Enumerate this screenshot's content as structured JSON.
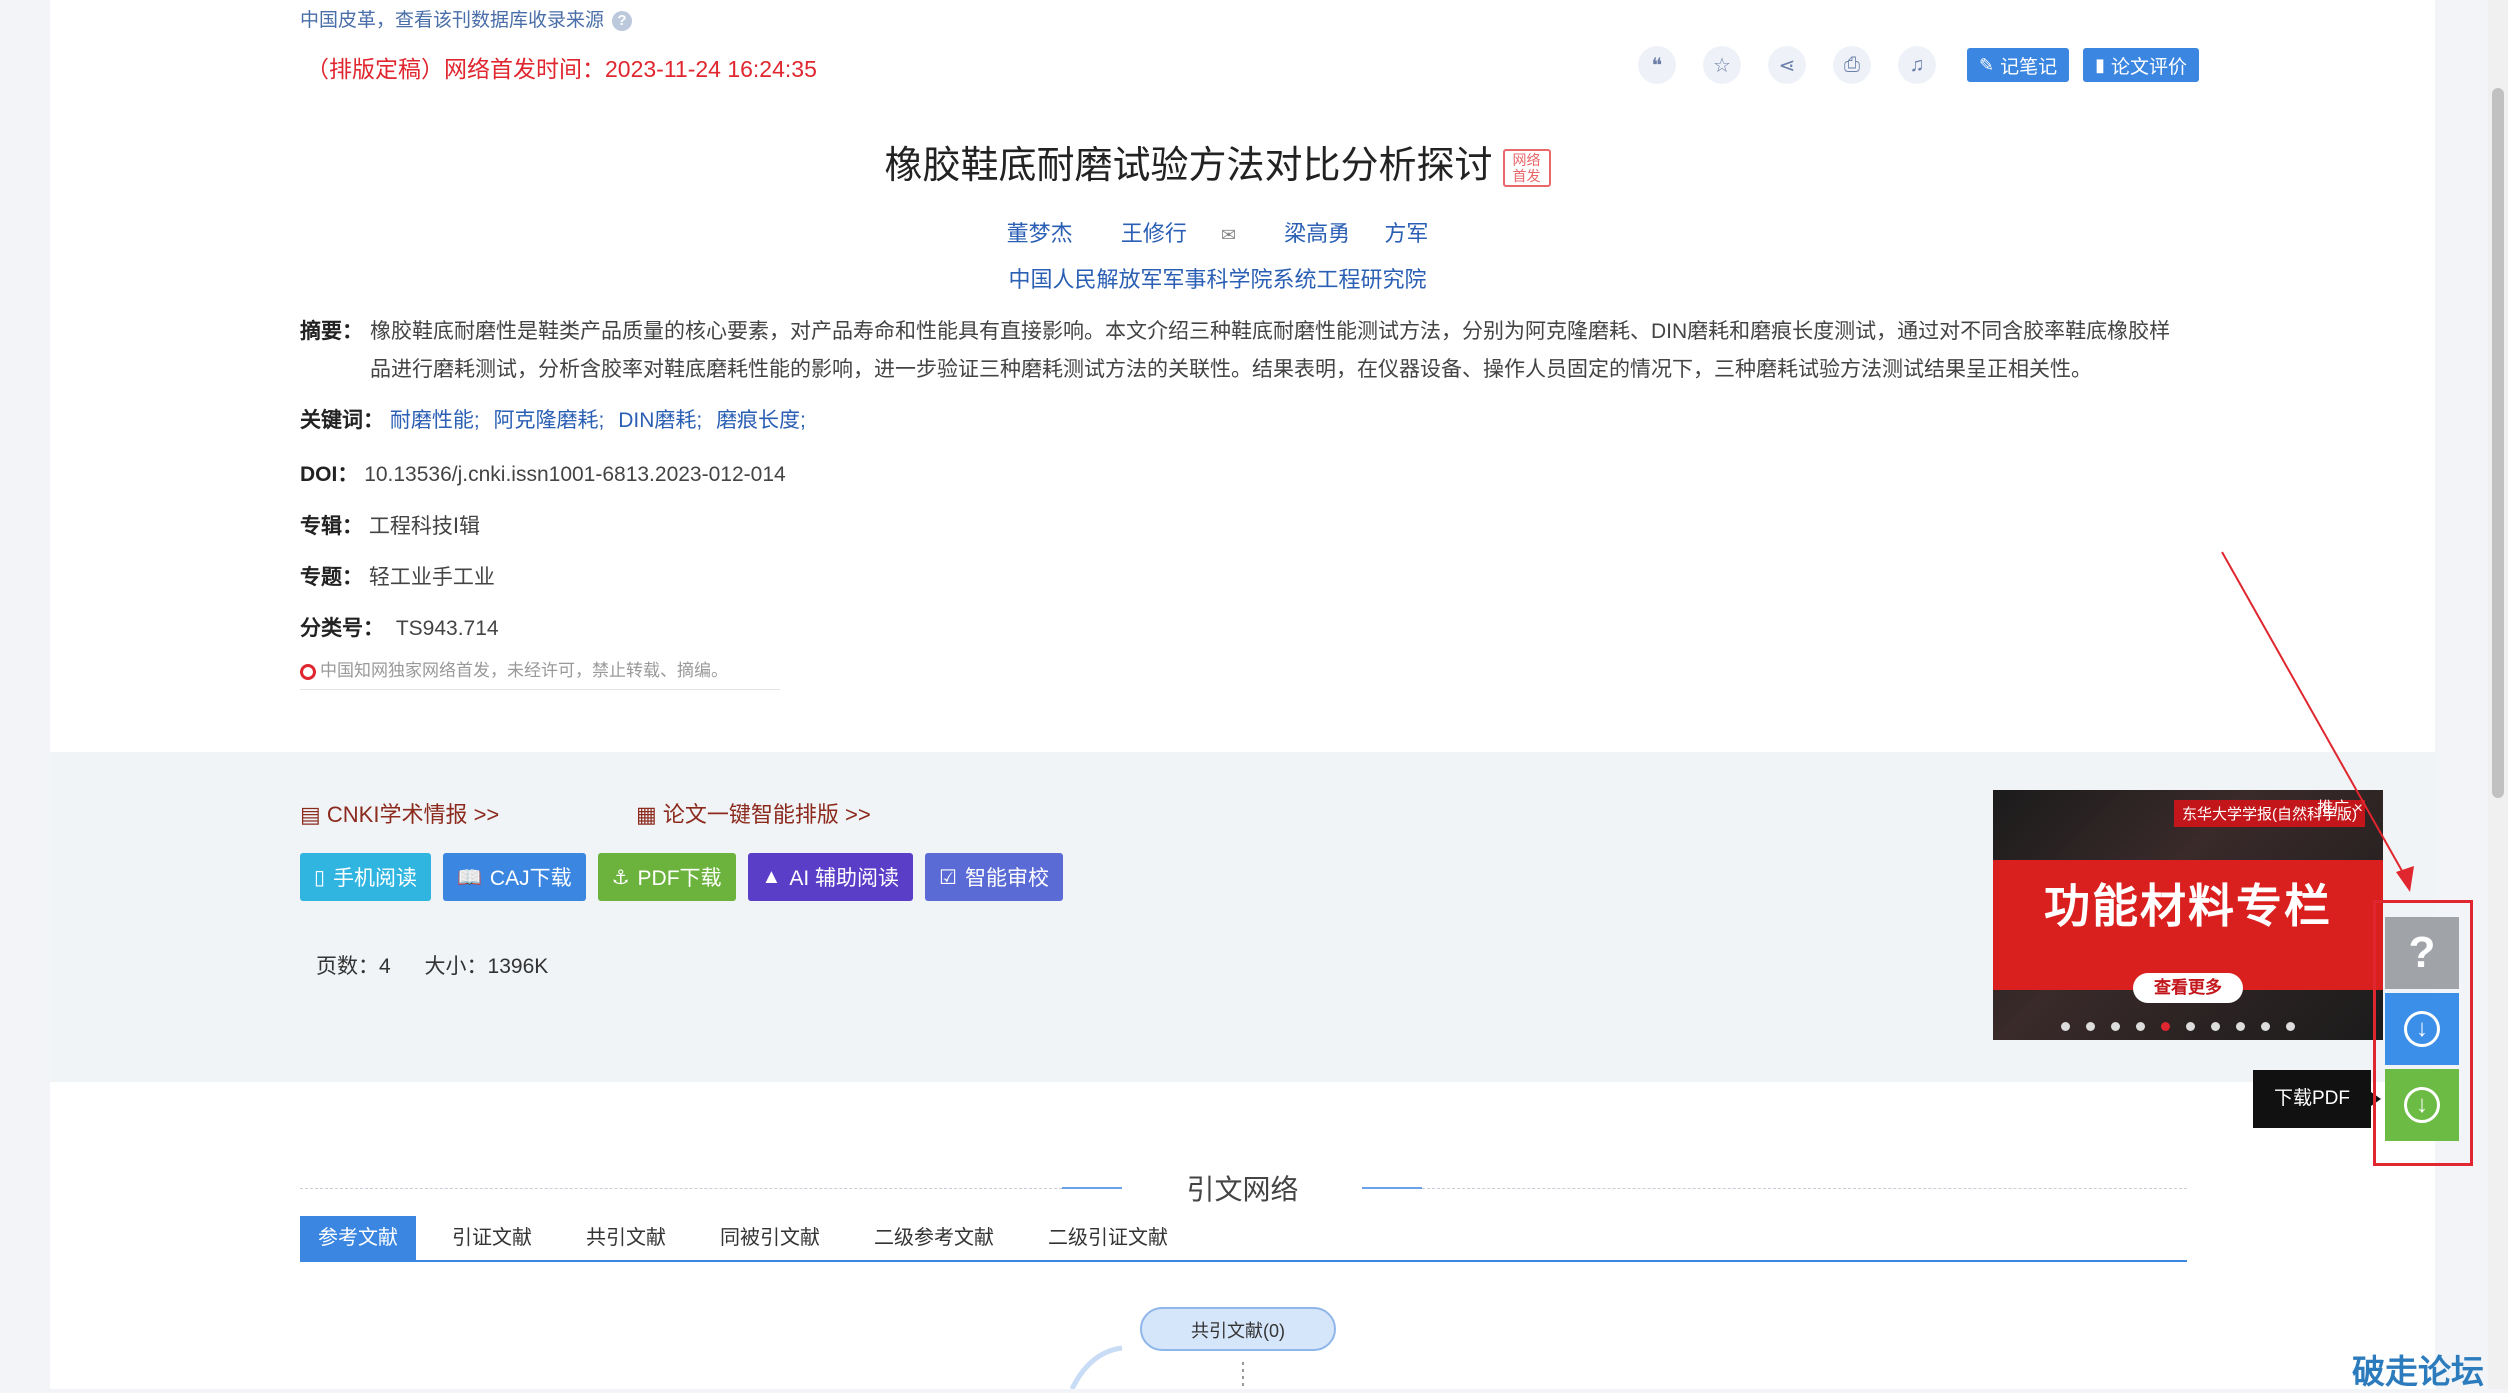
{
  "source_note": "中国皮革，查看该刊数据库收录来源",
  "help_icon": "?",
  "pub_time": "（排版定稿）网络首发时间：2023-11-24 16:24:35",
  "toolbar": {
    "icons": [
      "quote-icon",
      "star-icon",
      "share-icon",
      "print-icon",
      "bell-icon"
    ],
    "note_label": "记笔记",
    "eval_label": "论文评价"
  },
  "article": {
    "title": "橡胶鞋底耐磨试验方法对比分析探讨",
    "badge": "网络首发",
    "authors": [
      "董梦杰",
      "王修行",
      "梁高勇",
      "方军"
    ],
    "organization": "中国人民解放军军事科学院系统工程研究院",
    "abstract_label": "摘要：",
    "abstract": "橡胶鞋底耐磨性是鞋类产品质量的核心要素，对产品寿命和性能具有直接影响。本文介绍三种鞋底耐磨性能测试方法，分别为阿克隆磨耗、DIN磨耗和磨痕长度测试，通过对不同含胶率鞋底橡胶样品进行磨耗测试，分析含胶率对鞋底磨耗性能的影响，进一步验证三种磨耗测试方法的关联性。结果表明，在仪器设备、操作人员固定的情况下，三种磨耗试验方法测试结果呈正相关性。",
    "keywords_label": "关键词：",
    "keywords": [
      "耐磨性能;",
      "阿克隆磨耗;",
      "DIN磨耗;",
      "磨痕长度;"
    ],
    "doi_label": "DOI：",
    "doi": "10.13536/j.cnki.issn1001-6813.2023-012-014",
    "series_label": "专辑：",
    "series": "工程科技Ⅰ辑",
    "topic_label": "专题：",
    "topic": "轻工业手工业",
    "class_label": "分类号：",
    "class_no": "TS943.714",
    "notice": "中国知网独家网络首发，未经许可，禁止转载、摘编。"
  },
  "links": {
    "cnki": "CNKI学术情报 >>",
    "typeset": "论文一键智能排版 >>"
  },
  "actions": [
    {
      "label": "手机阅读",
      "color": "#2fb5e0",
      "icon": "phone-icon"
    },
    {
      "label": "CAJ下载",
      "color": "#3a86e0",
      "icon": "book-icon"
    },
    {
      "label": "PDF下载",
      "color": "#6cb33e",
      "icon": "pdf-icon"
    },
    {
      "label": "AI 辅助阅读",
      "color": "#5b3ec8",
      "icon": "ai-icon"
    },
    {
      "label": "智能审校",
      "color": "#5b6bd6",
      "icon": "check-icon"
    }
  ],
  "meta": {
    "pages_label": "页数：",
    "pages": "4",
    "size_label": "大小：",
    "size": "1396K"
  },
  "ad": {
    "journal": "东华大学学报(自然科学版)",
    "tui": "推广 ×",
    "headline": "功能材料专栏",
    "more": "查看更多",
    "slides": 10,
    "active_slide": 4
  },
  "float_buttons": {
    "help": "?",
    "tooltip": "下载PDF"
  },
  "citation": {
    "section_title": "引文网络",
    "tabs": [
      "参考文献",
      "引证文献",
      "共引文献",
      "同被引文献",
      "二级参考文献",
      "二级引证文献"
    ],
    "active_tab": 0,
    "node": "共引文献(0)"
  },
  "watermark": "破走论坛",
  "colors": {
    "accent": "#3a86e0",
    "red": "#e0262e",
    "link": "#2a5fb4"
  }
}
